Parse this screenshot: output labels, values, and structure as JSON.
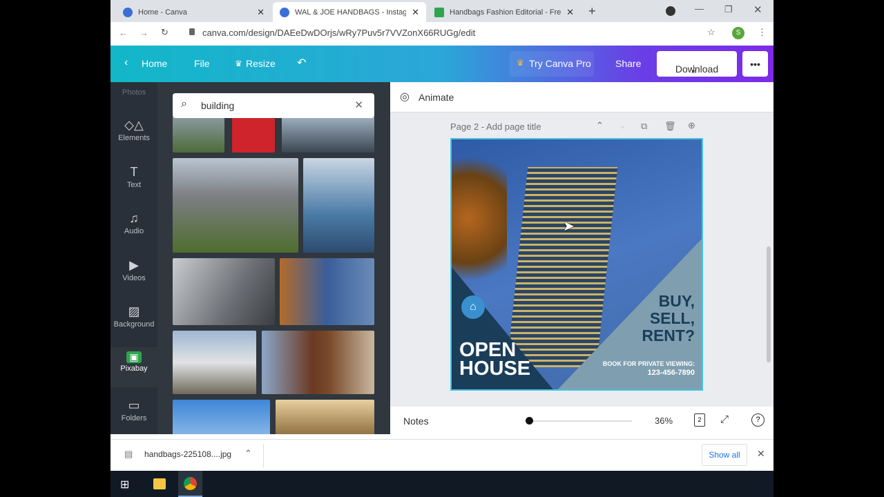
{
  "browser": {
    "tabs": [
      {
        "label": "Home - Canva"
      },
      {
        "label": "WAL & JOE HANDBAGS - Instagram"
      },
      {
        "label": "Handbags Fashion Editorial - Free"
      }
    ],
    "url": "canva.com/design/DAEeDwDOrjs/wRy7Puv5r7VVZonX66RUGg/edit",
    "profile_initial": "S"
  },
  "header": {
    "home": "Home",
    "file": "File",
    "resize": "Resize",
    "try_pro": "Try Canva Pro",
    "share": "Share",
    "download": "Download",
    "more": "•••"
  },
  "rail": {
    "top_partial": "Photos",
    "items": [
      {
        "label": "Elements",
        "icon": "◇△"
      },
      {
        "label": "Text",
        "icon": "T"
      },
      {
        "label": "Audio",
        "icon": "♫"
      },
      {
        "label": "Videos",
        "icon": "▶"
      },
      {
        "label": "Background",
        "icon": "▨"
      },
      {
        "label": "Pixabay",
        "icon": "▣"
      },
      {
        "label": "Folders",
        "icon": "▭"
      }
    ]
  },
  "search": {
    "value": "building"
  },
  "editor": {
    "animate": "Animate",
    "page_title": "Page 2 - Add page title",
    "notes": "Notes",
    "zoom": "36%",
    "page_count": "2",
    "zoom_level": 0.36
  },
  "design": {
    "headline": "OPEN\nHOUSE",
    "tagline": "BUY,\nSELL,\nRENT?",
    "cta": "BOOK FOR PRIVATE VIEWING:",
    "phone": "123-456-7890"
  },
  "downloads": {
    "file": "handbags-225108....jpg",
    "show_all": "Show all"
  }
}
